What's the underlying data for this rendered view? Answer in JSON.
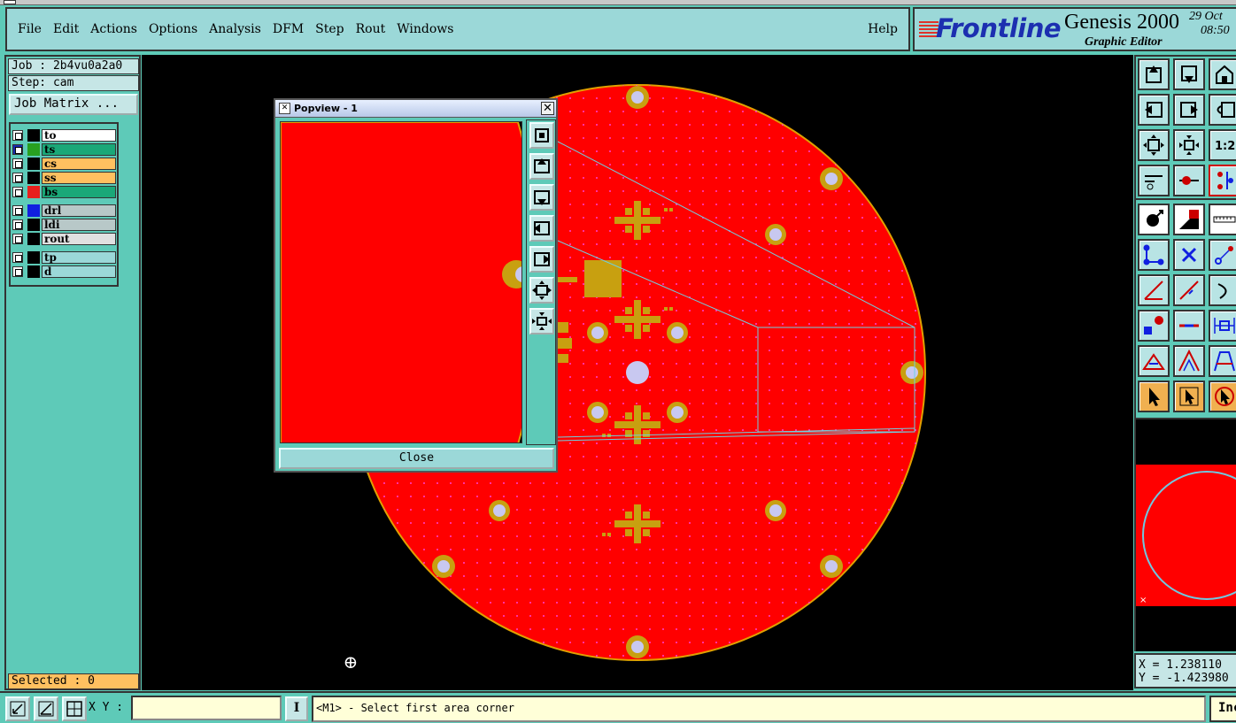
{
  "menubar": {
    "items": [
      "File",
      "Edit",
      "Actions",
      "Options",
      "Analysis",
      "DFM",
      "Step",
      "Rout",
      "Windows"
    ],
    "help": "Help"
  },
  "brand": {
    "logo": "Frontline",
    "product": "Genesis 2000",
    "subtitle": "Graphic Editor",
    "date": "29 Oct",
    "time": "08:50"
  },
  "job": {
    "job_line": "Job : 2b4vu0a2a0",
    "step_line": "Step: cam",
    "matrix_button": "Job Matrix ..."
  },
  "layers": [
    {
      "name": "to",
      "color": "#000000",
      "bg": "#ffffff",
      "checked": false
    },
    {
      "name": "ts",
      "color": "#28a020",
      "bg": "#1aa878",
      "checked": true
    },
    {
      "name": "cs",
      "color": "#000000",
      "bg": "#ffc060",
      "checked": false
    },
    {
      "name": "ss",
      "color": "#000000",
      "bg": "#ffc060",
      "checked": false
    },
    {
      "name": "bs",
      "color": "#e8201c",
      "bg": "#1aa878",
      "checked": false
    },
    {
      "name": "drl",
      "color": "#1020e0",
      "bg": "#b8c8c8",
      "checked": false
    },
    {
      "name": "ldi",
      "color": "#000000",
      "bg": "#b8c8c8",
      "checked": false
    },
    {
      "name": "rout",
      "color": "#000000",
      "bg": "#e0e0e0",
      "checked": false
    },
    {
      "name": "tp",
      "color": "#000000",
      "bg": "#9bd8d8",
      "checked": false
    },
    {
      "name": "d",
      "color": "#000000",
      "bg": "#9bd8d8",
      "checked": false
    }
  ],
  "selected": "Selected : 0",
  "popview": {
    "title": "Popview - 1",
    "close_button": "Close"
  },
  "coords": {
    "x": "X = 1.238110",
    "y": "Y = -1.423980"
  },
  "bottom": {
    "xy_label": "X Y :",
    "xy_value": "",
    "info_button": "I",
    "status": "<M1> - Select first area corner",
    "units": "Inc"
  },
  "colors": {
    "board_fill": "#ff0000",
    "board_outline": "#e0a000",
    "pad": "#c8a010",
    "hole": "#c8c8f0",
    "panel_bg": "#5ecab8",
    "menubar_bg": "#9bd8d8"
  }
}
